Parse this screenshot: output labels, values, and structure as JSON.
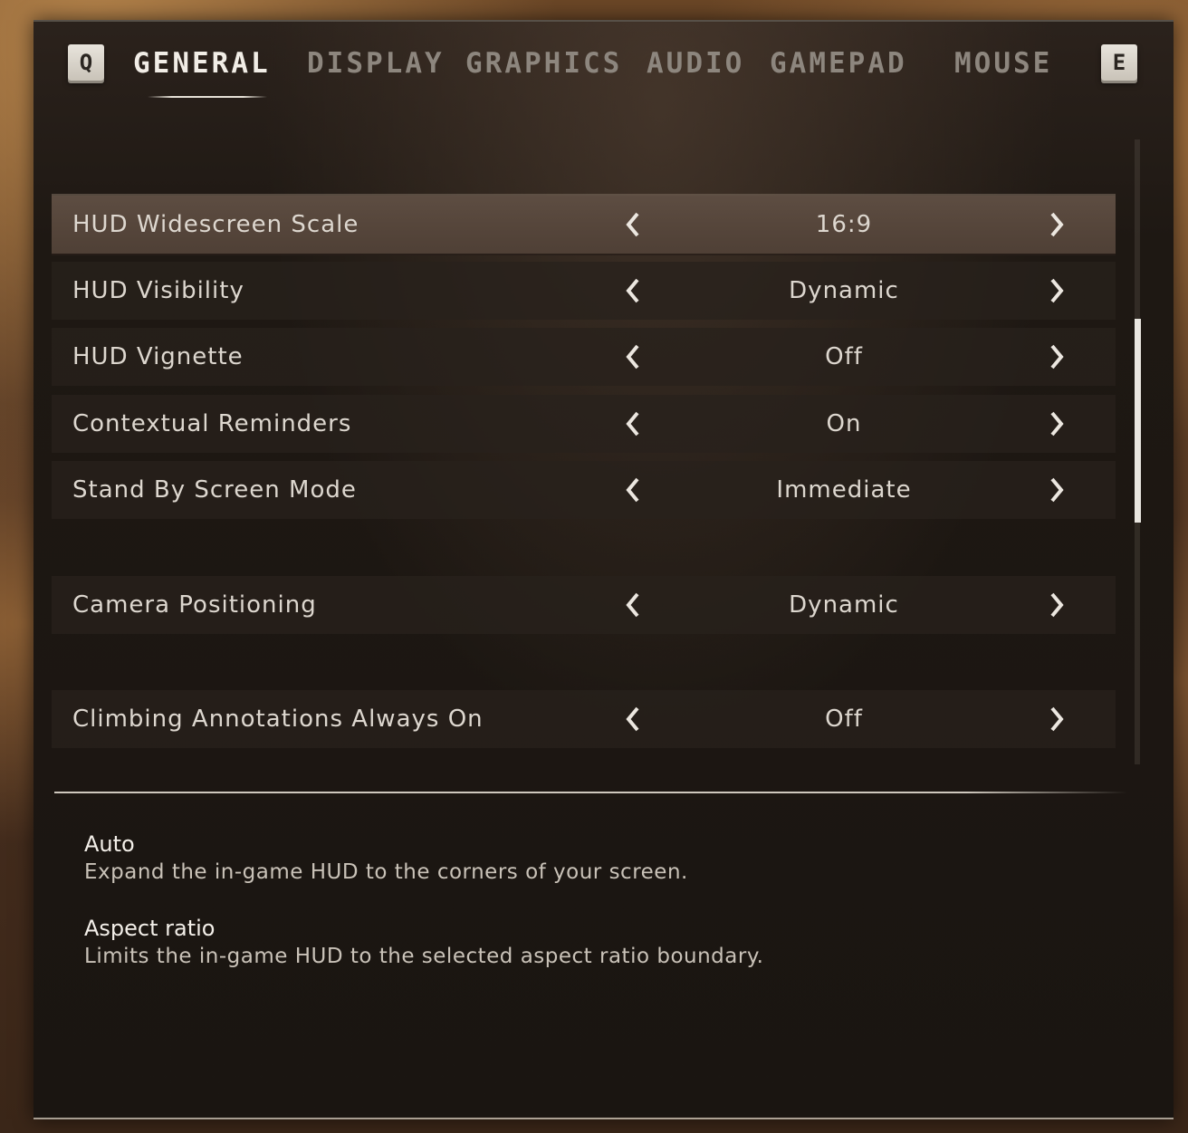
{
  "tabs": {
    "prev_key": "Q",
    "next_key": "E",
    "items": [
      "GENERAL",
      "DISPLAY",
      "GRAPHICS",
      "AUDIO",
      "GAMEPAD",
      "MOUSE"
    ],
    "active": "GENERAL"
  },
  "settings": [
    {
      "label": "HUD Widescreen Scale",
      "value": "16:9"
    },
    {
      "label": "HUD Visibility",
      "value": "Dynamic"
    },
    {
      "label": "HUD Vignette",
      "value": "Off"
    },
    {
      "label": "Contextual Reminders",
      "value": "On"
    },
    {
      "label": "Stand By Screen Mode",
      "value": "Immediate"
    },
    {
      "label": "Camera Positioning",
      "value": "Dynamic"
    },
    {
      "label": "Climbing Annotations Always On",
      "value": "Off"
    }
  ],
  "selected_setting": "HUD Widescreen Scale",
  "description": [
    {
      "title": "Auto",
      "text": "Expand the in-game HUD to the corners of your screen."
    },
    {
      "title": "Aspect ratio",
      "text": "Limits the in-game HUD to the selected aspect ratio boundary."
    }
  ],
  "colors": {
    "panel_bg": "#1e1813",
    "selected_row": "#56463b",
    "text": "#ddd7cf",
    "active_tab": "#f1ede6",
    "inactive_tab": "#8d867e"
  },
  "icons": {
    "prev_option": "chevron-left-icon",
    "next_option": "chevron-right-icon"
  }
}
